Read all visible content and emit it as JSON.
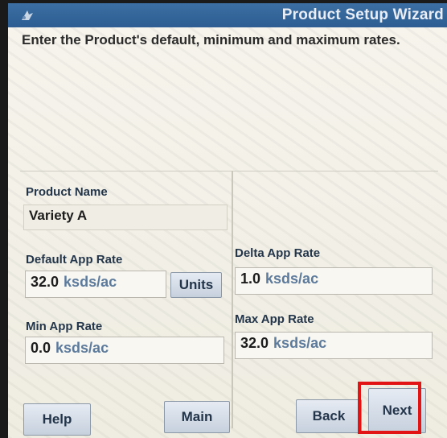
{
  "window": {
    "title": "Product Setup Wizard"
  },
  "instructions": "Enter the Product's default, minimum and maximum rates.",
  "product": {
    "label": "Product Name",
    "value": "Variety A"
  },
  "default_rate": {
    "label": "Default App Rate",
    "value": "32.0",
    "unit": "ksds/ac",
    "units_button": "Units"
  },
  "delta_rate": {
    "label": "Delta App Rate",
    "value": "1.0",
    "unit": "ksds/ac"
  },
  "min_rate": {
    "label": "Min App Rate",
    "value": "0.0",
    "unit": "ksds/ac"
  },
  "max_rate": {
    "label": "Max App Rate",
    "value": "32.0",
    "unit": "ksds/ac"
  },
  "buttons": {
    "help": "Help",
    "main": "Main",
    "back": "Back",
    "next": "Next"
  },
  "colors": {
    "titlebar": "#2d5d92",
    "highlight": "#e31414"
  }
}
